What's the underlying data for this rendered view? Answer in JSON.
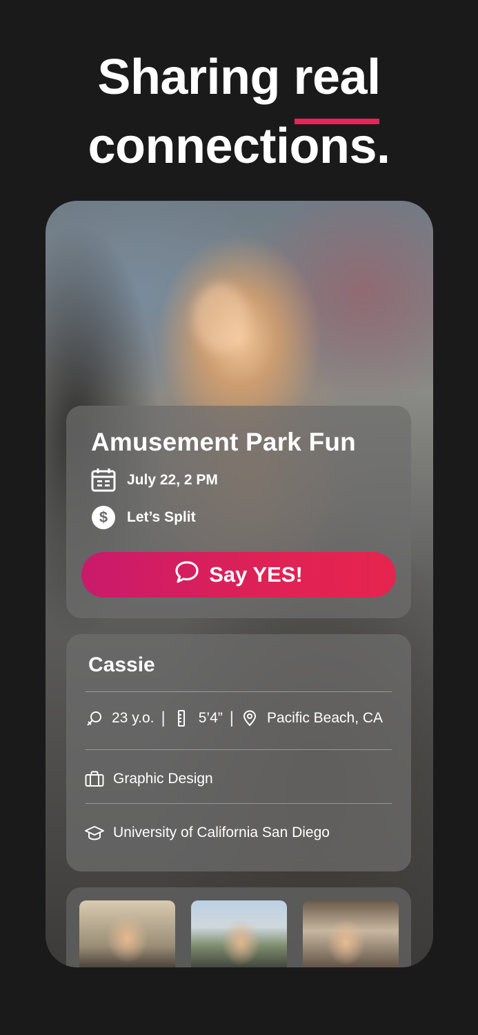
{
  "headline": {
    "line1_prefix": "Sharing ",
    "line1_accent": "real",
    "line2": "connections.",
    "accent_color": "#e8245a"
  },
  "event": {
    "title": "Amusement Park Fun",
    "date": "July 22, 2 PM",
    "payment": "Let’s Split",
    "cta_label": "Say YES!",
    "cta_gradient": [
      "#c91a6b",
      "#e6244f"
    ]
  },
  "profile": {
    "name": "Cassie",
    "age": "23 y.o.",
    "height": "5’4”",
    "location": "Pacific Beach, CA",
    "occupation": "Graphic Design",
    "school": "University of California San Diego"
  },
  "icons": {
    "date": "calendar-icon",
    "payment": "dollar-icon",
    "cta": "chat-bubble-icon",
    "age": "gender-icon",
    "height": "ruler-icon",
    "location": "location-pin-icon",
    "occupation": "briefcase-icon",
    "school": "graduation-cap-icon"
  },
  "photos": {
    "count": 3
  }
}
